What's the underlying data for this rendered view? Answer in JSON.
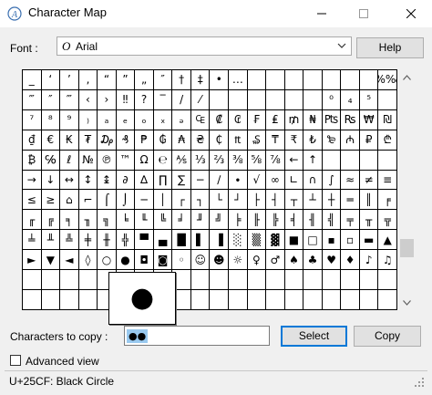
{
  "window": {
    "title": "Character Map"
  },
  "font": {
    "label": "Font :",
    "value": "Arial",
    "help_label": "Help"
  },
  "grid": [
    [
      "_",
      "‘",
      "’",
      "‚",
      "“",
      "”",
      "„",
      "″",
      "†",
      "‡",
      "•",
      "…",
      "",
      "",
      "",
      "",
      "",
      "",
      "",
      "%‰"
    ],
    [
      "‴",
      "″",
      "‴",
      "‹",
      "›",
      "‼",
      "?",
      "‾",
      "/",
      "⁄",
      "",
      "",
      "",
      "",
      "",
      "",
      "⁰",
      "₄",
      "⁵",
      ""
    ],
    [
      "⁷",
      "⁸",
      "⁹",
      "₎",
      "ₐ",
      "ₑ",
      "ₒ",
      "ₓ",
      "ₔ",
      "₠",
      "₡",
      "₢",
      "₣",
      "₤",
      "₥",
      "₦",
      "₧",
      "₨",
      "₩",
      "₪"
    ],
    [
      "₫",
      "€",
      "₭",
      "₮",
      "₯",
      "₰",
      "₱",
      "₲",
      "₳",
      "₴",
      "₵",
      "₶",
      "₷",
      "₸",
      "₹",
      "₺",
      "₻",
      "₼",
      "₽",
      "₾"
    ],
    [
      "₿",
      "℅",
      "ℓ",
      "№",
      "℗",
      "™",
      "Ω",
      "℮",
      "⅍",
      "⅓",
      "⅔",
      "⅜",
      "⅝",
      "⅞",
      "←",
      "↑"
    ],
    [
      "→",
      "↓",
      "↔",
      "↕",
      "↨",
      "∂",
      "∆",
      "∏",
      "∑",
      "−",
      "∕",
      "∙",
      "√",
      "∞",
      "∟",
      "∩",
      "∫",
      "≈",
      "≠",
      "≡"
    ],
    [
      "≤",
      "≥",
      "⌂",
      "⌐",
      "⌠",
      "⌡",
      "─",
      "│",
      "┌",
      "┐",
      "└",
      "┘",
      "├",
      "┤",
      "┬",
      "┴",
      "┼",
      "═",
      "║",
      "╒"
    ],
    [
      "╓",
      "╔",
      "╕",
      "╖",
      "╗",
      "╘",
      "╙",
      "╚",
      "╛",
      "╜",
      "╝",
      "╞",
      "╟",
      "╠",
      "╡",
      "╢",
      "╣",
      "╤",
      "╥",
      "╦"
    ],
    [
      "╧",
      "╨",
      "╩",
      "╪",
      "╫",
      "╬",
      "▀",
      "▄",
      "█",
      "▌",
      "▐",
      "░",
      "▒",
      "▓",
      "■",
      "□",
      "▪",
      "▫",
      "▬",
      "▲"
    ],
    [
      "►",
      "▼",
      "◄",
      "◊",
      "○",
      "●",
      "◘",
      "◙",
      "◦",
      "☺",
      "☻",
      "☼",
      "♀",
      "♂",
      "♠",
      "♣",
      "♥",
      "♦",
      "♪",
      "♫"
    ]
  ],
  "zoom_char": "●",
  "copy": {
    "label": "Characters to copy :",
    "value": "●●",
    "select_label": "Select",
    "copy_label": "Copy"
  },
  "advanced": {
    "label": "Advanced view"
  },
  "status": {
    "text": "U+25CF: Black Circle"
  },
  "colors": {
    "accent": "#0078d7",
    "selection": "#99c9ef"
  }
}
